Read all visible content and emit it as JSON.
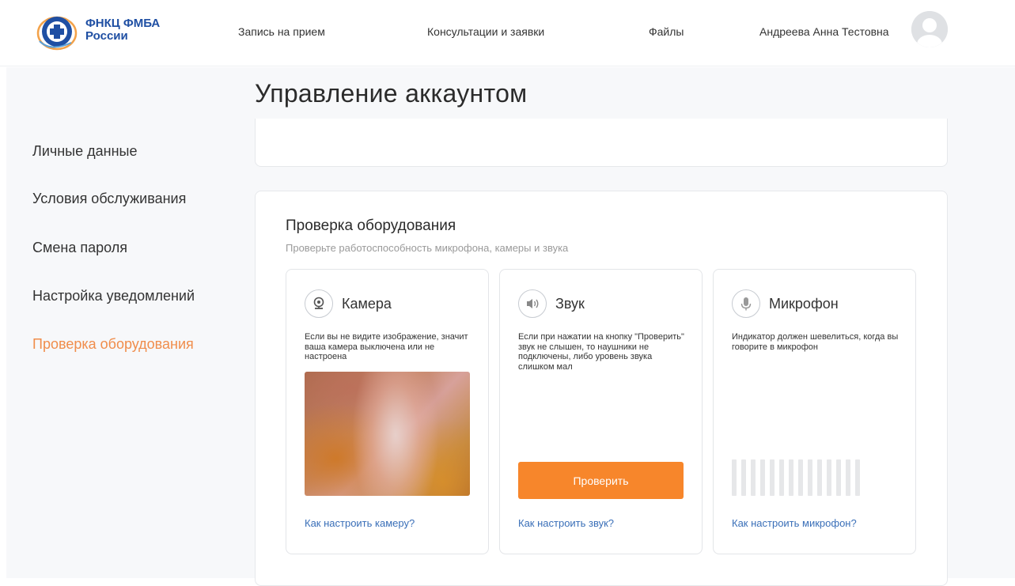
{
  "brand": {
    "line1": "ФНКЦ ФМБА",
    "line2": "России"
  },
  "nav": {
    "appointment": "Запись на прием",
    "consultations": "Консультации и заявки",
    "files": "Файлы"
  },
  "user": {
    "name": "Андреева Анна Тестовна"
  },
  "page_title": "Управление аккаунтом",
  "sidebar": {
    "items": [
      {
        "label": "Личные данные"
      },
      {
        "label": "Условия обслуживания"
      },
      {
        "label": "Смена пароля"
      },
      {
        "label": "Настройка уведомлений"
      },
      {
        "label": "Проверка оборудования",
        "active": true
      }
    ]
  },
  "equipment": {
    "title": "Проверка оборудования",
    "subtitle": "Проверьте работоспособность микрофона, камеры и звука",
    "camera": {
      "title": "Камера",
      "text": "Если вы не видите изображение, значит ваша камера выключена или не настроена",
      "link": "Как настроить камеру?"
    },
    "sound": {
      "title": "Звук",
      "text": "Если при нажатии на кнопку \"Проверить\" звук не слышен, то наушники не подключены, либо уровень звука слишком мал",
      "button": "Проверить",
      "link": "Как настроить звук?"
    },
    "microphone": {
      "title": "Микрофон",
      "text": "Индикатор должен шевелиться, когда вы говорите в микрофон",
      "link": "Как настроить микрофон?",
      "level": 0
    }
  },
  "colors": {
    "accent": "#f7862b",
    "active_sidebar": "#f08d4b",
    "link": "#3a6fb8",
    "brand": "#1f4fa3"
  }
}
